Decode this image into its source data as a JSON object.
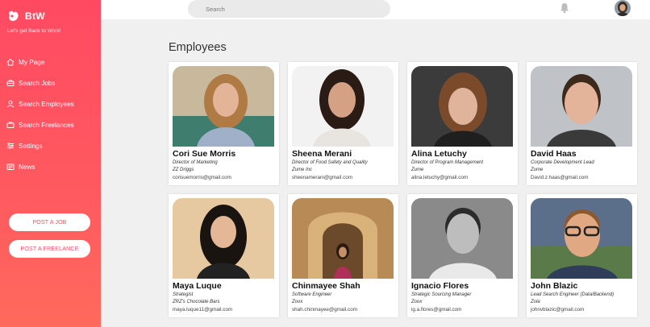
{
  "brand": {
    "name": "BtW",
    "tagline": "Let's get Back to Work!"
  },
  "nav": [
    {
      "label": "My Page",
      "icon": "home-icon"
    },
    {
      "label": "Search Jobs",
      "icon": "briefcase-icon"
    },
    {
      "label": "Search Employees",
      "icon": "user-icon"
    },
    {
      "label": "Search Freelances",
      "icon": "case-icon"
    },
    {
      "label": "Settings",
      "icon": "sliders-icon"
    },
    {
      "label": "News",
      "icon": "newspaper-icon"
    }
  ],
  "actions": {
    "post_job": "POST A JOB",
    "post_freelance": "POST A FREELANCE"
  },
  "topbar": {
    "search_placeholder": "Search"
  },
  "page": {
    "title": "Employees"
  },
  "employees": [
    {
      "name": "Cori Sue Morris",
      "title": "Director of Marketing",
      "company": "ZZ Driggs",
      "email": "corisuemorris@gmail.com"
    },
    {
      "name": "Sheena Merani",
      "title": "Director of Food Safety and Quality",
      "company": "Zume Inc",
      "email": "sheenamerani@gmail.com"
    },
    {
      "name": "Alina Letuchy",
      "title": "Director of Program Management",
      "company": "Zume",
      "email": "alina.letuchy@gmail.com"
    },
    {
      "name": "David Haas",
      "title": "Corporate Development Lead",
      "company": "Zume",
      "email": "David.z.haas@gmail.com"
    },
    {
      "name": "Maya Luque",
      "title": "Strategist",
      "company": "ZRZ's Chocolate Bars",
      "email": "maya.luque11@gmail.com"
    },
    {
      "name": "Chinmayee Shah",
      "title": "Software Engineer",
      "company": "Zoox",
      "email": "shah.chinmayee@gmail.com"
    },
    {
      "name": "Ignacio Flores",
      "title": "Strategic Sourcing Manager",
      "company": "Zoox",
      "email": "ig.a.flores@gmail.com"
    },
    {
      "name": "John Blazic",
      "title": "Lead Search Engineer (Data/Backend)",
      "company": "Zola",
      "email": "johnvblazic@gmail.com"
    }
  ],
  "colors": {
    "accent": "#ff4a62",
    "background": "#f0f0f0"
  }
}
